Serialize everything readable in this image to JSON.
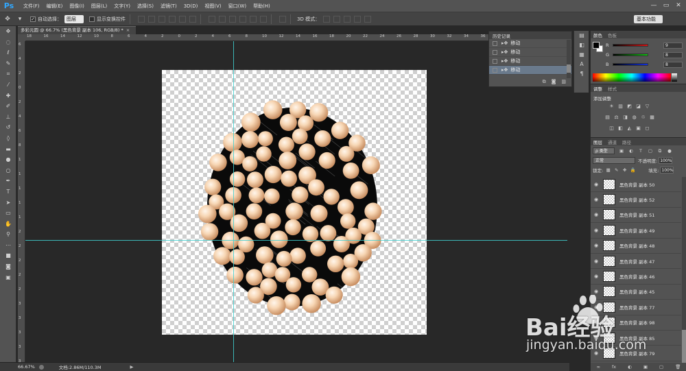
{
  "app": {
    "logo_text": "Ps",
    "menu": [
      "文件(F)",
      "编辑(E)",
      "图像(I)",
      "图层(L)",
      "文字(Y)",
      "选择(S)",
      "滤镜(T)",
      "3D(D)",
      "视图(V)",
      "窗口(W)",
      "帮助(H)"
    ],
    "window_controls": [
      "—",
      "▭",
      "✕"
    ]
  },
  "options_bar": {
    "auto_select_label": "自动选择：",
    "auto_select_value": "图层",
    "show_transform_label": "显示变换控件",
    "mode_3d_label": "3D 模式：",
    "workspace_value": "基本功能"
  },
  "document": {
    "tab_title": "多彩元圆 @ 66.7% (黑色背景 副本 106, RGB/8) *",
    "tab_close": "×"
  },
  "rulers": {
    "top_labels": [
      "18",
      "16",
      "14",
      "12",
      "10",
      "8",
      "6",
      "4",
      "2",
      "0",
      "2",
      "4",
      "6",
      "8",
      "10",
      "12",
      "14",
      "16",
      "18",
      "20",
      "22",
      "24",
      "26",
      "28",
      "30",
      "32",
      "34",
      "36",
      "38",
      "40",
      "42",
      "44"
    ],
    "left_labels": [
      "6",
      "4",
      "2",
      "0",
      "2",
      "4",
      "6",
      "8",
      "1",
      "1",
      "1",
      "1",
      "1",
      "2",
      "2",
      "2",
      "2",
      "2",
      "3",
      "3",
      "3",
      "3",
      "3"
    ]
  },
  "status_bar": {
    "zoom": "66.67%",
    "doc_info": "文档:2.86M/110.3M",
    "arrow": "▶"
  },
  "history_panel": {
    "tab_label": "历史记录",
    "items": [
      {
        "label": "移动"
      },
      {
        "label": "移动"
      },
      {
        "label": "移动"
      },
      {
        "label": "移动"
      }
    ],
    "active_index": 3
  },
  "color_panel": {
    "tabs": [
      "颜色",
      "色板"
    ],
    "sliders": [
      {
        "label": "R",
        "value": "9",
        "track_color": "#e01010"
      },
      {
        "label": "G",
        "value": "8",
        "track_color": "#10c010"
      },
      {
        "label": "B",
        "value": "8",
        "track_color": "#1030e0"
      }
    ]
  },
  "adjustments_panel": {
    "tabs": [
      "调整",
      "样式"
    ],
    "title": "添加调整",
    "row1": [
      "☀",
      "▥",
      "◩",
      "◪",
      "▽"
    ],
    "row2": [
      "▤",
      "⚖",
      "◨",
      "◍",
      "♲",
      "▦"
    ],
    "row3": [
      "◫",
      "◧",
      "◭",
      "▣",
      "◻"
    ]
  },
  "layers_panel": {
    "tabs": [
      "图层",
      "通道",
      "路径"
    ],
    "filter_select": "ρ 类型",
    "blend_mode": "正常",
    "opacity_label": "不透明度:",
    "opacity_value": "100%",
    "lock_label": "锁定:",
    "fill_label": "填充:",
    "fill_value": "100%",
    "layers": [
      {
        "name": "黑色背景 副本 50"
      },
      {
        "name": "黑色背景 副本 52"
      },
      {
        "name": "黑色背景 副本 51"
      },
      {
        "name": "黑色背景 副本 49"
      },
      {
        "name": "黑色背景 副本 48"
      },
      {
        "name": "黑色背景 副本 47"
      },
      {
        "name": "黑色背景 副本 46"
      },
      {
        "name": "黑色背景 副本 45"
      },
      {
        "name": "黑色背景 副本 77"
      },
      {
        "name": "黑色背景 副本 98"
      },
      {
        "name": "黑色背景 副本 85"
      },
      {
        "name": "黑色背景 副本 79"
      }
    ],
    "footer_icons": [
      "∞",
      "fx",
      "◐",
      "▣",
      "▢",
      "🗑"
    ]
  },
  "watermark": {
    "logo_text": "Bai经验",
    "url": "jingyan.baidu.com"
  },
  "colors": {
    "bead_light": "#fbe4cc",
    "bead_mid": "#f0c59e",
    "bead_dark": "#c98f62",
    "guide": "#3fd0d0"
  }
}
